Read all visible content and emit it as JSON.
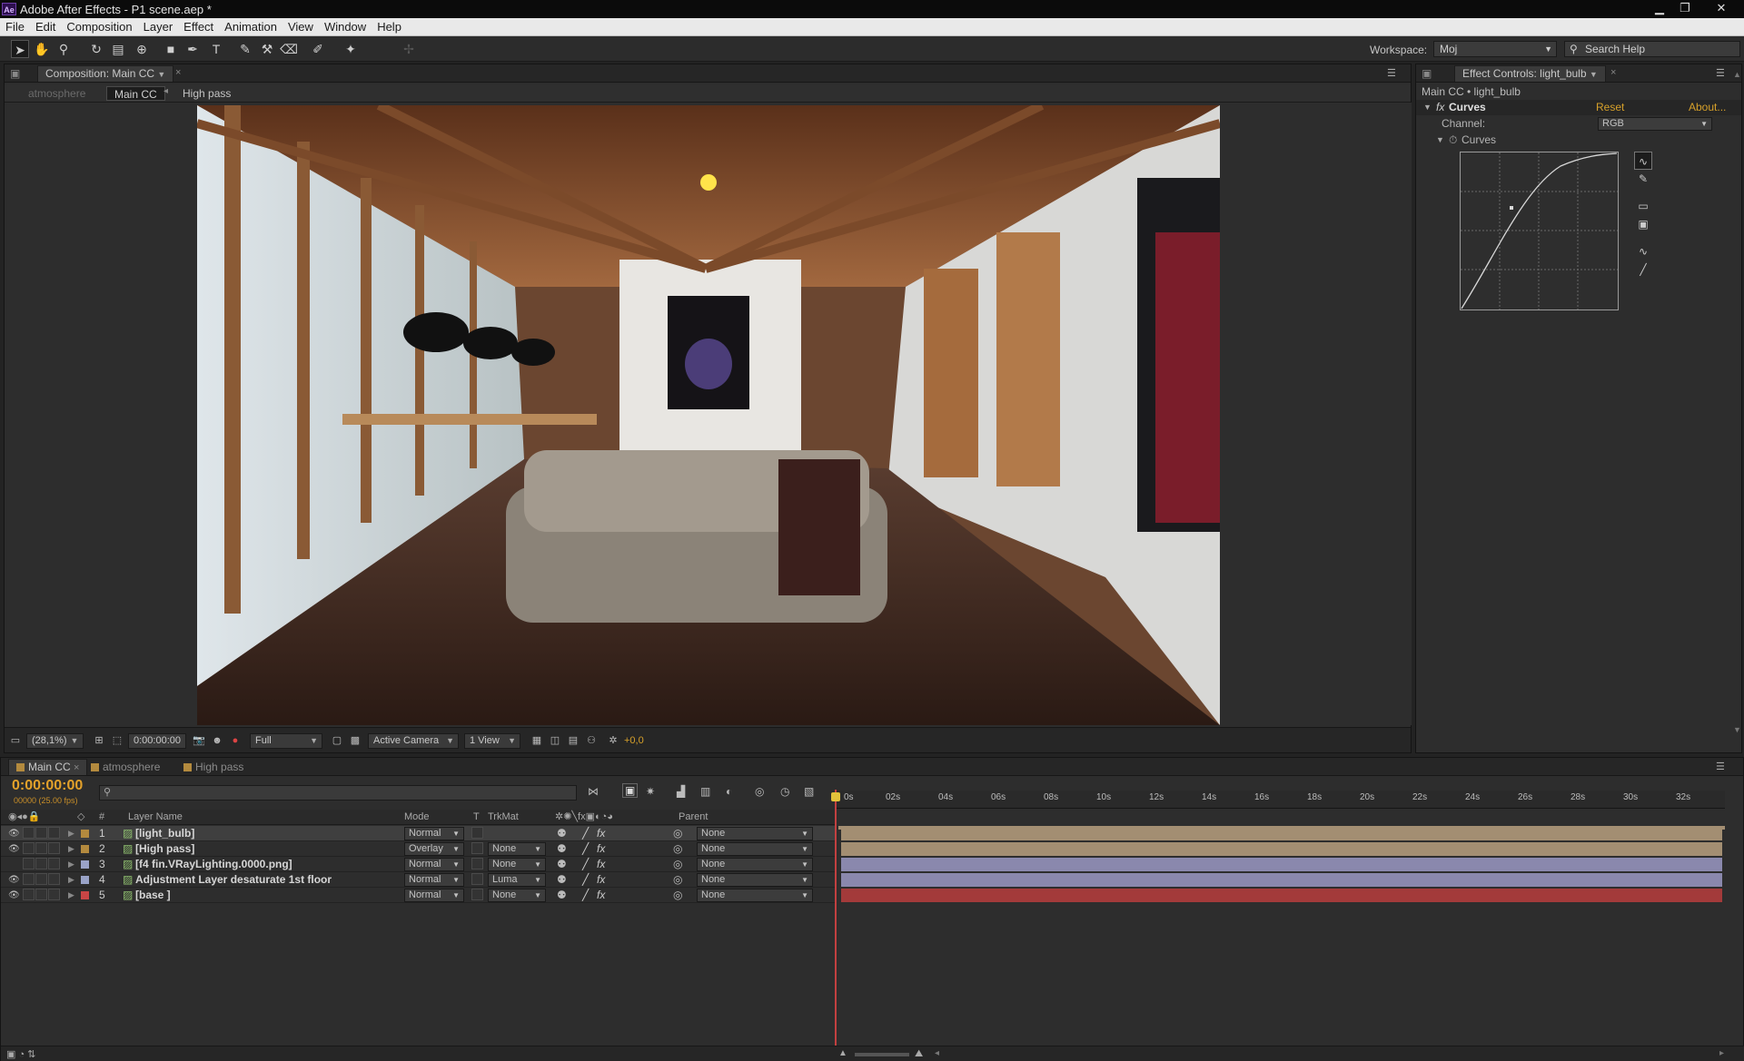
{
  "window": {
    "title": "Adobe After Effects - P1 scene.aep *",
    "app_badge": "Ae"
  },
  "menu": [
    "File",
    "Edit",
    "Composition",
    "Layer",
    "Effect",
    "Animation",
    "View",
    "Window",
    "Help"
  ],
  "toolbar": {
    "workspace_label": "Workspace:",
    "workspace_value": "Moj",
    "search_placeholder": "Search Help"
  },
  "comp_panel": {
    "tab": "Composition: Main CC",
    "breadcrumbs": [
      "atmosphere",
      "Main CC",
      "High pass"
    ],
    "footer": {
      "zoom": "(28,1%)",
      "timecode": "0:00:00:00",
      "resolution": "Full",
      "camera": "Active Camera",
      "views": "1 View",
      "exposure": "+0,0"
    }
  },
  "effect_controls": {
    "tab": "Effect Controls: light_bulb",
    "target": "Main CC • light_bulb",
    "effect_name": "Curves",
    "reset": "Reset",
    "about": "About...",
    "channel_label": "Channel:",
    "channel_value": "RGB",
    "curves_label": "Curves"
  },
  "timeline": {
    "tabs": [
      "Main CC",
      "atmosphere",
      "High pass"
    ],
    "timecode": "0:00:00:00",
    "frame_info": "00000 (25.00 fps)",
    "columns": {
      "num": "#",
      "layer_name": "Layer Name",
      "mode": "Mode",
      "t": "T",
      "trkmat": "TrkMat",
      "parent": "Parent"
    },
    "ruler": [
      "0s",
      "02s",
      "04s",
      "06s",
      "08s",
      "10s",
      "12s",
      "14s",
      "16s",
      "18s",
      "20s",
      "22s",
      "24s",
      "26s",
      "28s",
      "30s",
      "32s"
    ],
    "layers": [
      {
        "num": "1",
        "name": "[light_bulb]",
        "mode": "Normal",
        "trkmat": "",
        "parent": "None",
        "label_color": "#b38a3e",
        "bar_color": "#a38e72"
      },
      {
        "num": "2",
        "name": "[High pass]",
        "mode": "Overlay",
        "trkmat": "None",
        "parent": "None",
        "label_color": "#b38a3e",
        "bar_color": "#a38e72"
      },
      {
        "num": "3",
        "name": "[f4 fin.VRayLighting.0000.png]",
        "mode": "Normal",
        "trkmat": "None",
        "parent": "None",
        "label_color": "#9aa3c8",
        "bar_color": "#8a88ad"
      },
      {
        "num": "4",
        "name": "Adjustment Layer desaturate 1st floor",
        "mode": "Normal",
        "trkmat": "Luma",
        "parent": "None",
        "label_color": "#9aa3c8",
        "bar_color": "#8a88ad"
      },
      {
        "num": "5",
        "name": "[base ]",
        "mode": "Normal",
        "trkmat": "None",
        "parent": "None",
        "label_color": "#c94545",
        "bar_color": "#a33a3a"
      }
    ]
  },
  "colors": {
    "timecode": "#e3a12a",
    "accent": "#d6a02a",
    "bar_tan": "#a38e72",
    "bar_purple": "#8a88ad",
    "bar_red": "#a33a3a"
  }
}
